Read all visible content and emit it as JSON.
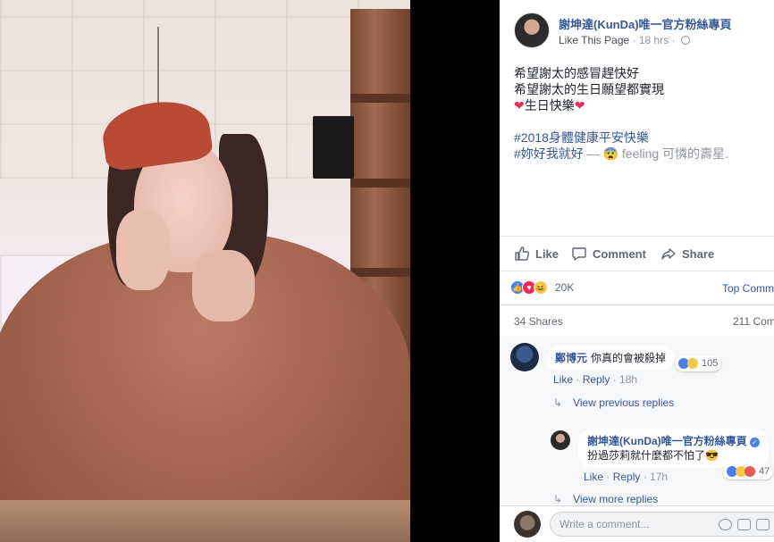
{
  "post": {
    "page_name": "謝坤達(KunDa)唯一官方粉絲專頁",
    "like_page": "Like This Page",
    "time_sep": " · 18 hrs · ",
    "lines": {
      "l1": "希望謝太的感冒趕快好",
      "l2": "希望謝太的生日願望都實現",
      "l3_heart": "❤",
      "l3_text": "生日快樂",
      "l3_heart2": "❤",
      "l4": "#2018身體健康平安快樂",
      "l5_tag": "#妳好我就好",
      "l5_dash": " — ",
      "l5_emoji": "😨",
      "l5_feeling": " feeling 可憐的壽星."
    }
  },
  "actions": {
    "like": "Like",
    "comment": "Comment",
    "share": "Share"
  },
  "stats": {
    "reaction_count": "20K",
    "top_comments": "Top Comm",
    "shares": "34 Shares",
    "comments": "211 Com"
  },
  "comments": {
    "c1": {
      "author": "鄭博元",
      "text": "你真的會被殺掉",
      "reaction_count": "105",
      "like": "Like",
      "reply": "Reply",
      "time": "18h"
    },
    "view_previous": "View previous replies",
    "c2": {
      "author": "謝坤達(KunDa)唯一官方粉絲專頁",
      "text": "扮過莎莉就什麼都不怕了😎",
      "reaction_count": "47",
      "like": "Like",
      "reply": "Reply",
      "time": "17h"
    },
    "view_more": "View more replies"
  },
  "composer": {
    "placeholder": "Write a comment..."
  },
  "colors": {
    "link": "#365899",
    "muted": "#90949c",
    "like_blue": "#4a7eea",
    "love_red": "#f0285a"
  }
}
